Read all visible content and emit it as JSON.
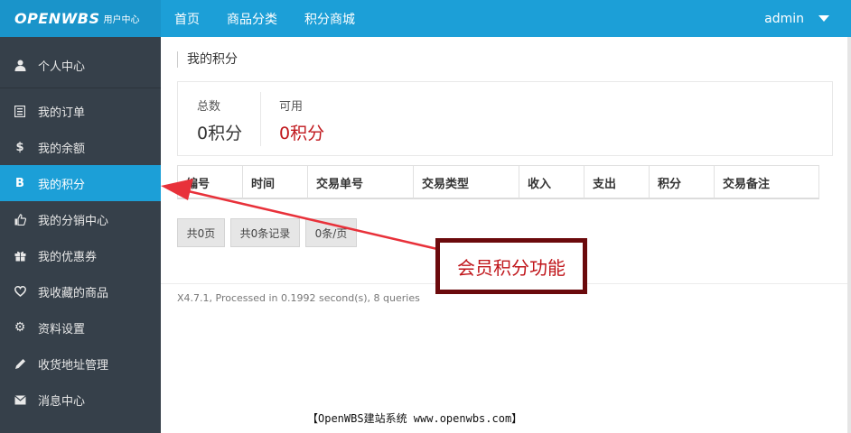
{
  "brand": {
    "logo": "OPENWBS",
    "subtitle": "用户中心"
  },
  "topnav": {
    "items": [
      "首页",
      "商品分类",
      "积分商城"
    ],
    "user": "admin"
  },
  "sidebar": {
    "items": [
      {
        "label": "个人中心",
        "icon": "user-icon"
      },
      {
        "label": "我的订单",
        "icon": "list-icon"
      },
      {
        "label": "我的余额",
        "icon": "dollar-icon"
      },
      {
        "label": "我的积分",
        "icon": "bitcoin-icon",
        "active": true
      },
      {
        "label": "我的分销中心",
        "icon": "thumbs-up-icon"
      },
      {
        "label": "我的优惠券",
        "icon": "gift-icon"
      },
      {
        "label": "我收藏的商品",
        "icon": "heart-icon"
      },
      {
        "label": "资料设置",
        "icon": "gear-icon"
      },
      {
        "label": "收货地址管理",
        "icon": "pencil-icon"
      },
      {
        "label": "消息中心",
        "icon": "envelope-icon"
      }
    ]
  },
  "main": {
    "title": "我的积分",
    "stats": {
      "total_label": "总数",
      "total_value": "0积分",
      "available_label": "可用",
      "available_value": "0积分"
    },
    "table": {
      "columns": [
        "编号",
        "时间",
        "交易单号",
        "交易类型",
        "收入",
        "支出",
        "积分",
        "交易备注"
      ]
    },
    "pager": {
      "pages": "共0页",
      "records": "共0条记录",
      "per_page": "0条/页"
    },
    "footer": "X4.7.1, Processed in 0.1992 second(s), 8 queries"
  },
  "annotation": {
    "text": "会员积分功能"
  },
  "watermark": "【OpenWBS建站系统 www.openwbs.com】",
  "colors": {
    "primary": "#1c9fd7",
    "sidebar": "#36404a",
    "accent_red": "#c0161b",
    "annotation_border": "#6b0a0c"
  }
}
